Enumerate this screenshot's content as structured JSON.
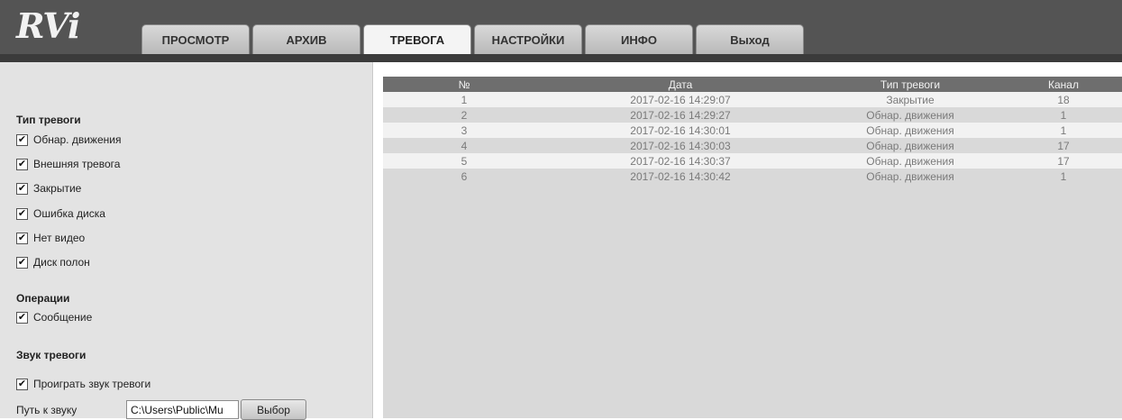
{
  "logo": {
    "text": "RVi"
  },
  "tabs": [
    {
      "label": "ПРОСМОТР",
      "active": false
    },
    {
      "label": "АРХИВ",
      "active": false
    },
    {
      "label": "ТРЕВОГА",
      "active": true
    },
    {
      "label": "НАСТРОЙКИ",
      "active": false
    },
    {
      "label": "ИНФО",
      "active": false
    },
    {
      "label": "Выход",
      "active": false
    }
  ],
  "sidebar": {
    "alarm_type_title": "Тип тревоги",
    "alarm_types": [
      {
        "label": "Обнар. движения",
        "checked": true
      },
      {
        "label": "Внешняя тревога",
        "checked": true
      },
      {
        "label": "Закрытие",
        "checked": true
      },
      {
        "label": "Ошибка диска",
        "checked": true
      },
      {
        "label": "Нет видео",
        "checked": true
      },
      {
        "label": "Диск полон",
        "checked": true
      }
    ],
    "operations_title": "Операции",
    "operations": [
      {
        "label": "Сообщение",
        "checked": true
      }
    ],
    "sound_title": "Звук тревоги",
    "play_sound": {
      "label": "Проиграть звук тревоги",
      "checked": true
    },
    "sound_path_label": "Путь к звуку",
    "sound_path_value": "C:\\Users\\Public\\Mu",
    "choose_button": "Выбор"
  },
  "table": {
    "headers": [
      "№",
      "Дата",
      "Тип тревоги",
      "Канал"
    ],
    "rows": [
      [
        "1",
        "2017-02-16 14:29:07",
        "Закрытие",
        "18"
      ],
      [
        "2",
        "2017-02-16 14:29:27",
        "Обнар. движения",
        "1"
      ],
      [
        "3",
        "2017-02-16 14:30:01",
        "Обнар. движения",
        "1"
      ],
      [
        "4",
        "2017-02-16 14:30:03",
        "Обнар. движения",
        "17"
      ],
      [
        "5",
        "2017-02-16 14:30:37",
        "Обнар. движения",
        "17"
      ],
      [
        "6",
        "2017-02-16 14:30:42",
        "Обнар. движения",
        "1"
      ]
    ]
  },
  "checkmark": "✔"
}
